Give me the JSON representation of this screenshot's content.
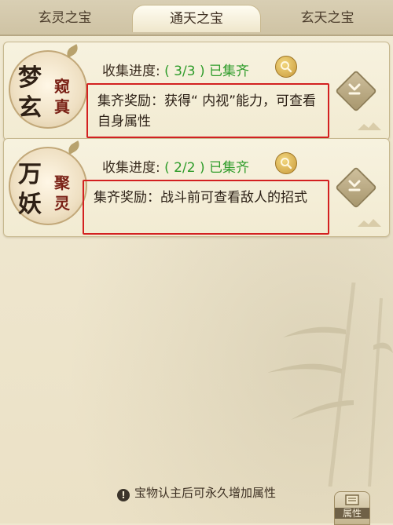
{
  "tabs": [
    {
      "label": "玄灵之宝"
    },
    {
      "label": "通天之宝"
    },
    {
      "label": "玄天之宝"
    }
  ],
  "items": [
    {
      "emblem": {
        "big1": "梦",
        "big2": "玄",
        "small1": "窥",
        "small2": "真"
      },
      "progress_label": "收集进度:",
      "progress_count": "( 3/3 )",
      "progress_status": "已集齐",
      "reward_text": "集齐奖励：获得“ 内视”能力，可查看自身属性"
    },
    {
      "emblem": {
        "big1": "万",
        "big2": "妖",
        "small1": "聚",
        "small2": "灵"
      },
      "progress_label": "收集进度:",
      "progress_count": "( 2/2 )",
      "progress_status": "已集齐",
      "reward_text": "集齐奖励：战斗前可查看敌人的招式"
    }
  ],
  "footer": {
    "note": "宝物认主后可永久增加属性",
    "warn_icon": "!",
    "attr_button_label": "属性"
  },
  "colors": {
    "accent_green": "#2f9c2a",
    "highlight_red": "#d32020"
  }
}
